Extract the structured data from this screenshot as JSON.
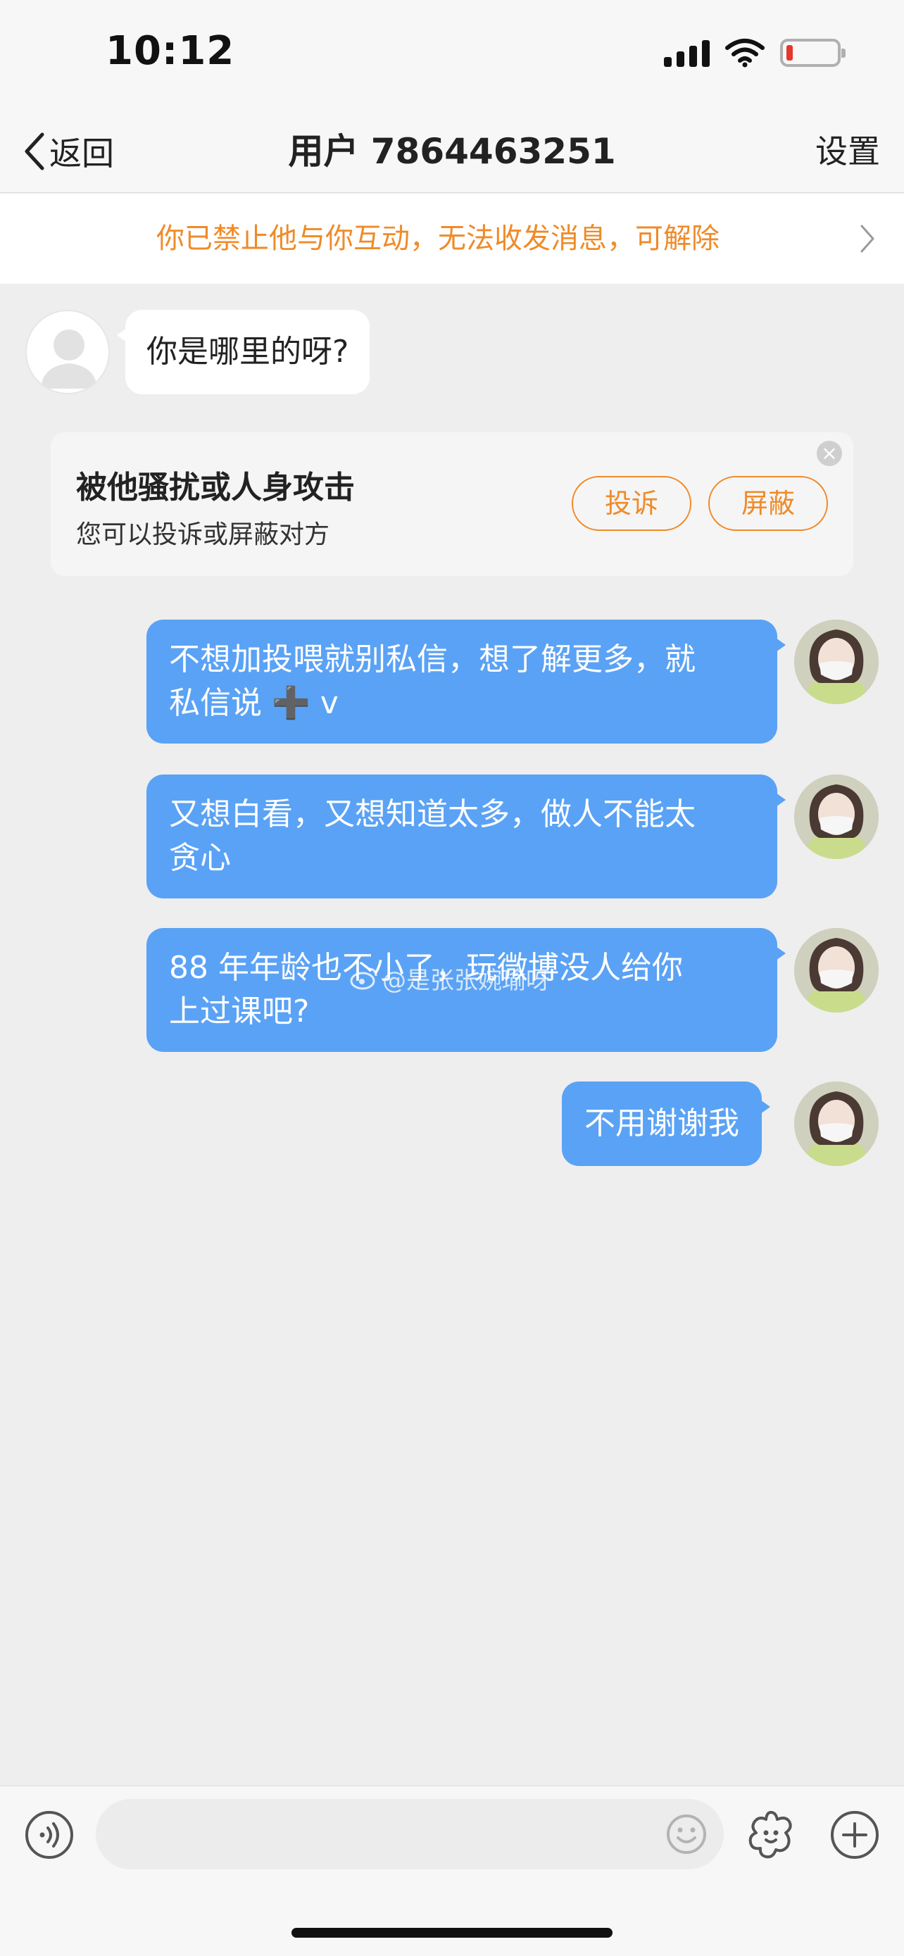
{
  "status_bar": {
    "time": "10:12",
    "battery_color": "#e5372b"
  },
  "nav": {
    "back_label": "返回",
    "title": "用户 7864463251",
    "settings_label": "设置"
  },
  "banner": {
    "text": "你已禁止他与你互动，无法收发消息，可解除",
    "color": "#ef8b29"
  },
  "messages": [
    {
      "direction": "incoming",
      "text": "你是哪里的呀?"
    },
    {
      "direction": "outgoing",
      "lines": [
        "不想加投喂就别私信，想了解更多，就",
        "私信说 ➕ v"
      ]
    },
    {
      "direction": "outgoing",
      "lines": [
        "又想白看，又想知道太多，做人不能太",
        "贪心"
      ]
    },
    {
      "direction": "outgoing",
      "lines": [
        "88 年年龄也不小了，玩微博没人给你",
        "上过课吧?"
      ]
    },
    {
      "direction": "outgoing",
      "text": "不用谢谢我"
    }
  ],
  "report_card": {
    "title": "被他骚扰或人身攻击",
    "subtitle": "您可以投诉或屏蔽对方",
    "complain_label": "投诉",
    "block_label": "屏蔽"
  },
  "watermark": "@是张张婉瑜呀",
  "theme": {
    "outgoing_bubble": "#5aa2f5",
    "incoming_bubble": "#ffffff",
    "background": "#eeeeee",
    "accent": "#ef8b29"
  },
  "icons": {
    "voice": "voice-icon",
    "emoji": "emoji-icon",
    "sticker": "sticker-icon",
    "more": "plus-icon"
  }
}
